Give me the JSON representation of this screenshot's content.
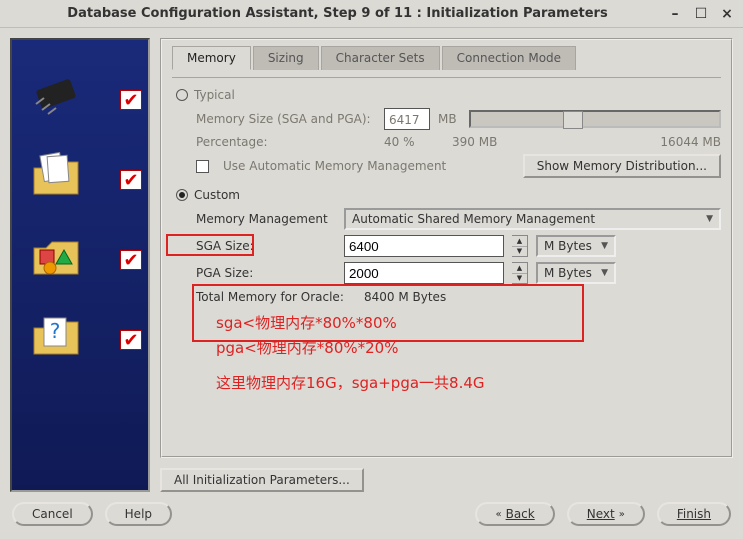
{
  "title": "Database Configuration Assistant, Step 9 of 11 : Initialization Parameters",
  "tabs": {
    "memory": "Memory",
    "sizing": "Sizing",
    "charsets": "Character Sets",
    "connmode": "Connection Mode"
  },
  "typical": {
    "label": "Typical",
    "memSizeLabel": "Memory Size (SGA and PGA):",
    "memSizeValue": "6417",
    "memSizeUnit": "MB",
    "pctLabel": "Percentage:",
    "pctValue": "40 %",
    "minLabel": "390 MB",
    "maxLabel": "16044 MB",
    "ammLabel": "Use Automatic Memory Management",
    "showDistBtn": "Show Memory Distribution..."
  },
  "custom": {
    "label": "Custom",
    "memMgmtLabel": "Memory Management",
    "memMgmtValue": "Automatic Shared Memory Management",
    "sgaLabel": "SGA Size:",
    "sgaValue": "6400",
    "sgaUnit": "M Bytes",
    "pgaLabel": "PGA Size:",
    "pgaValue": "2000",
    "pgaUnit": "M Bytes",
    "totalLabel": "Total Memory for Oracle:",
    "totalValue": "8400 M Bytes"
  },
  "annotations": {
    "line1": "sga<物理内存*80%*80%",
    "line2": "pga<物理内存*80%*20%",
    "line3": "这里物理内存16G，sga+pga一共8.4G"
  },
  "allInitBtn": "All Initialization Parameters...",
  "nav": {
    "cancel": "Cancel",
    "help": "Help",
    "back": "Back",
    "next": "Next",
    "finish": "Finish"
  }
}
